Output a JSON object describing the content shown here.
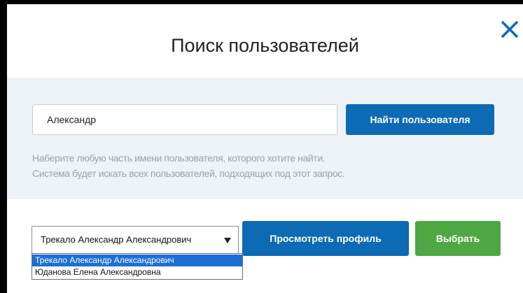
{
  "dialog": {
    "title": "Поиск пользователей",
    "close_icon": "close-icon"
  },
  "search": {
    "value": "Александр",
    "find_button": "Найти пользователя",
    "hint_line1": "Наберите любую часть имени пользователя, которого хотите найти.",
    "hint_line2": "Система будет искать всех пользователей, подходящих под этот запрос."
  },
  "results": {
    "selected": "Трекало Александр Александрович",
    "options": [
      "Трекало Александр Александрович",
      "Юданова Елена Александровна"
    ],
    "view_profile_button": "Просмотреть профиль",
    "select_button": "Выбрать",
    "arrow_icon": "chevron-down-icon"
  },
  "colors": {
    "primary": "#0d6ab4",
    "success": "#4fa744",
    "panel": "#eef3f7",
    "highlight": "#1b6fd6"
  }
}
